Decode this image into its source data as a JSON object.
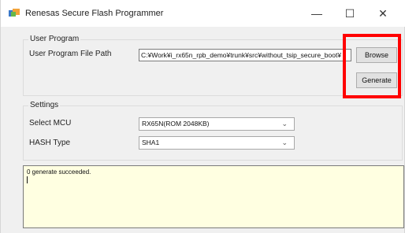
{
  "window": {
    "title": "Renesas Secure Flash Programmer",
    "controls": {
      "minimize": "—",
      "maximize": "☐",
      "close": "✕"
    }
  },
  "user_program": {
    "group_title": "User Program",
    "file_path_label": "User Program File Path",
    "file_path_value": "C:¥Work¥i_rx65n_rpb_demo¥trunk¥src¥without_tsip_secure_boot¥",
    "browse_label": "Browse",
    "generate_label": "Generate"
  },
  "settings": {
    "group_title": "Settings",
    "select_mcu_label": "Select MCU",
    "select_mcu_value": "RX65N(ROM 2048KB)",
    "hash_type_label": "HASH Type",
    "hash_type_value": "SHA1"
  },
  "output": {
    "text": "0 generate succeeded."
  },
  "colors": {
    "highlight": "#ff0000",
    "output_background": "#ffffe1"
  }
}
